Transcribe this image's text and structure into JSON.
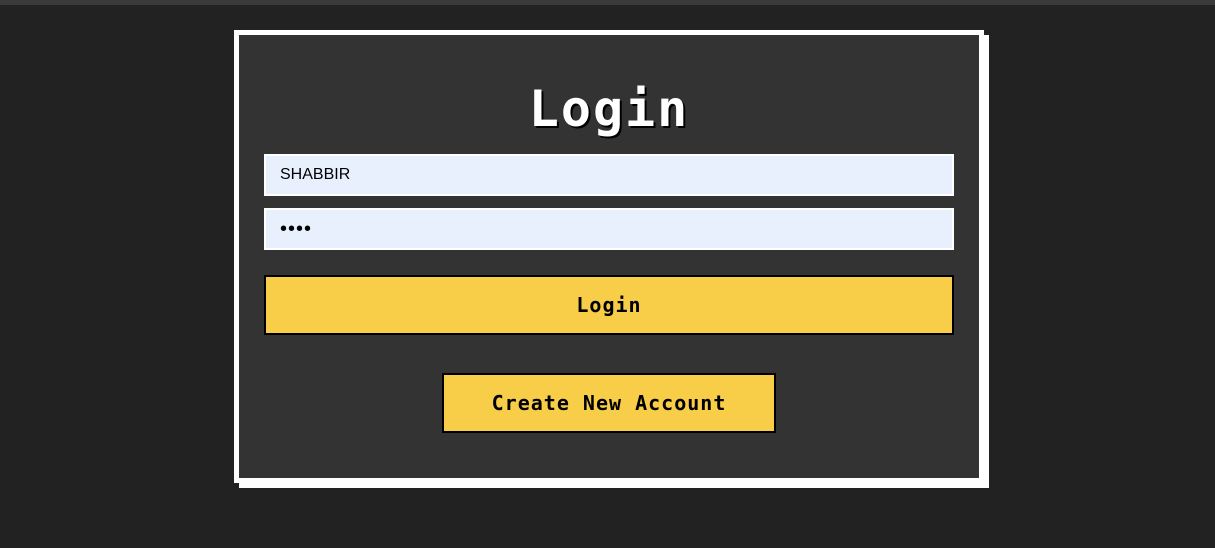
{
  "login_form": {
    "title": "Login",
    "username_value": "SHABBIR",
    "password_value": "1234",
    "login_button_label": "Login",
    "create_account_label": "Create New Account"
  },
  "colors": {
    "page_background": "#222222",
    "card_background": "#333333",
    "card_border": "#ffffff",
    "input_background": "#e8f0fe",
    "button_accent": "#f8cd47"
  }
}
